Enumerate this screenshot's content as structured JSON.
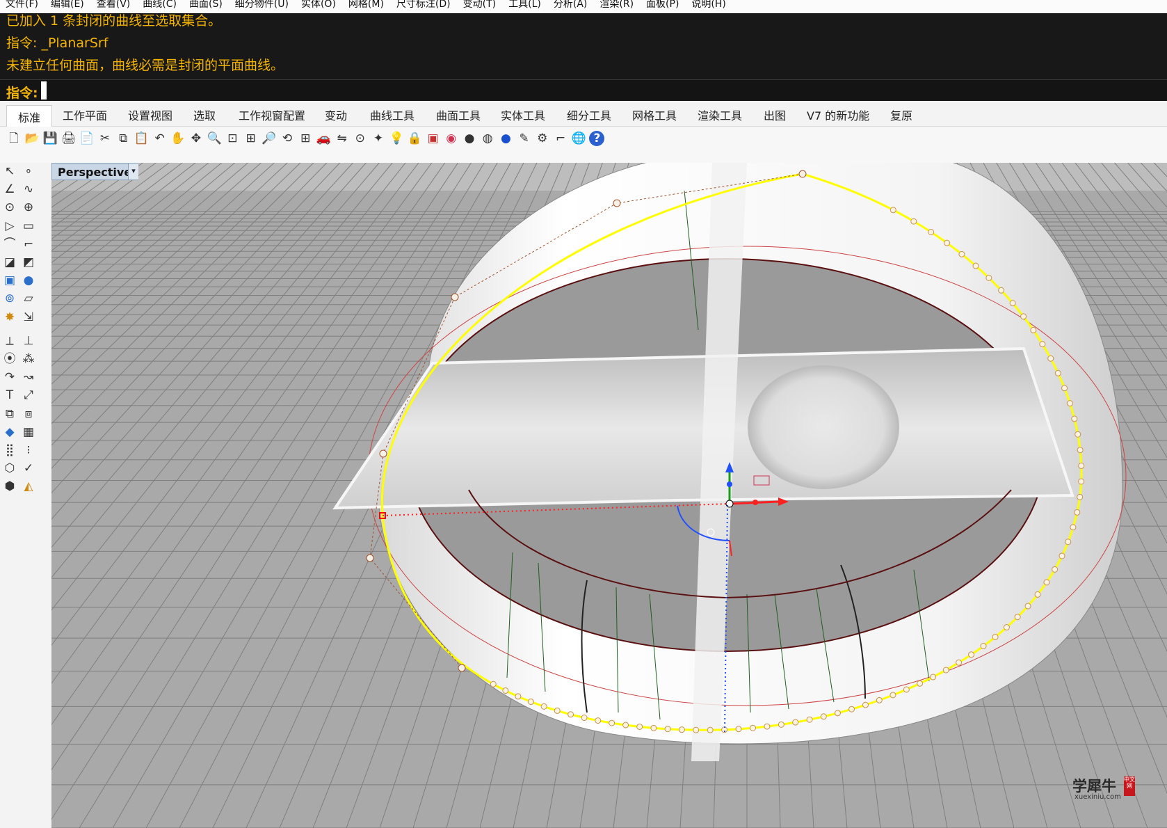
{
  "menu": [
    "文件(F)",
    "编辑(E)",
    "查看(V)",
    "曲线(C)",
    "曲面(S)",
    "细分物件(U)",
    "实体(O)",
    "网格(M)",
    "尺寸标注(D)",
    "变动(T)",
    "工具(L)",
    "分析(A)",
    "渲染(R)",
    "面板(P)",
    "说明(H)"
  ],
  "command": {
    "history": [
      "已加入 1 条封闭的曲线至选取集合。",
      "指令: _PlanarSrf",
      "未建立任何曲面，曲线必需是封闭的平面曲线。"
    ],
    "prompt": "指令:"
  },
  "tabs": [
    "标准",
    "工作平面",
    "设置视图",
    "选取",
    "工作视窗配置",
    "变动",
    "曲线工具",
    "曲面工具",
    "实体工具",
    "细分工具",
    "网格工具",
    "渲染工具",
    "出图",
    "V7 的新功能",
    "复原"
  ],
  "active_tab": "标准",
  "toolbar_icons": [
    "new-file-icon",
    "open-icon",
    "save-icon",
    "print-icon",
    "import-icon",
    "cut-icon",
    "copy-icon",
    "paste-icon",
    "undo-icon",
    "pan-icon",
    "rotate-view-icon",
    "zoom-dynamic-icon",
    "zoom-window-icon",
    "zoom-extents-icon",
    "zoom-selected-icon",
    "rotate-icon",
    "four-views-icon",
    "car-icon",
    "mirror-icon",
    "grid-snap-icon",
    "point-icon",
    "light-icon",
    "lock-icon",
    "render-icon",
    "color-wheel-icon",
    "sphere-icon",
    "rendered-sphere-icon",
    "blue-sphere-icon",
    "highlight-icon",
    "gear-icon",
    "dimension-icon",
    "globe-icon",
    "help-icon"
  ],
  "left_tools": [
    "select-icon",
    "point-icon",
    "polyline-icon",
    "curve-icon",
    "circle-icon",
    "ellipse-icon",
    "polygon-icon",
    "rectangle-icon",
    "arc-icon",
    "fillet-curve-icon",
    "surface-icon",
    "loft-icon",
    "box-icon",
    "sphere-icon",
    "cylinder-icon",
    "plane-surface-icon",
    "explode-icon",
    "join-icon",
    "split-icon",
    "trim-icon",
    "group-icon",
    "block-icon",
    "offset-icon",
    "extend-icon",
    "text-icon",
    "dimension-icon",
    "transform-icon",
    "array-icon",
    "solid-icon",
    "mesh-icon",
    "grid-icon",
    "control-points-icon",
    "cage-icon",
    "check-icon",
    "analyze-icon",
    "render-icon"
  ],
  "viewport": {
    "name": "Perspective",
    "colors": {
      "background": "#a9a9a9",
      "grid": "#7f7f7f",
      "curve_yellow": "#ffff00",
      "curve_brown": "#5a1010",
      "curve_red": "#cc4444",
      "isocurve_green": "#1f5f1f"
    }
  },
  "watermark": {
    "main": "学犀牛",
    "sub": "xuexiniu.com",
    "seal": "中文网"
  }
}
